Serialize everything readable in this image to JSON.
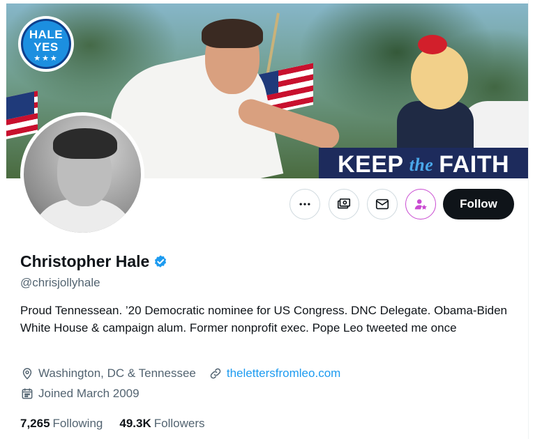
{
  "banner": {
    "badge": {
      "line1": "HALE",
      "line2": "YES",
      "stars": "★★★"
    },
    "slogan": {
      "part1": "KEEP",
      "part2": "the",
      "part3": "FAITH"
    }
  },
  "actions": {
    "more_icon": "more-horizontal-icon",
    "monetization_icon": "money-icon",
    "message_icon": "envelope-icon",
    "subscribe_icon": "person-star-icon",
    "follow_label": "Follow"
  },
  "profile": {
    "name": "Christopher Hale",
    "verified": true,
    "handle": "@chrisjollyhale",
    "bio": "Proud Tennessean. ’20 Democratic nominee for US Congress. DNC Delegate. Obama-Biden White House & campaign alum. Former nonprofit exec. Pope Leo tweeted me once",
    "location": "Washington, DC & Tennessee",
    "website": "thelettersfromleo.com",
    "joined": "Joined March 2009"
  },
  "stats": {
    "following_count": "7,265",
    "following_label": "Following",
    "followers_count": "49.3K",
    "followers_label": "Followers"
  },
  "colors": {
    "accent": "#1d9bf0",
    "text": "#0f1419",
    "muted": "#536471",
    "subscribe": "#c94bd1",
    "follow_bg": "#0f1419"
  }
}
